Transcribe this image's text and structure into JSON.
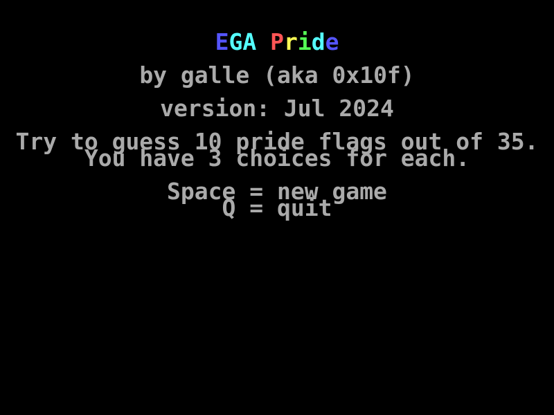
{
  "screen": {
    "background": "#000000",
    "text_color": "#AAAAAA"
  },
  "title": {
    "text": "EGA Pride",
    "letters": [
      {
        "char": "E",
        "color": "#5555FF"
      },
      {
        "char": "G",
        "color": "#55FFFF"
      },
      {
        "char": "A",
        "color": "#55FFFF"
      },
      {
        "char": " ",
        "color": "#000000"
      },
      {
        "char": "P",
        "color": "#FF5555"
      },
      {
        "char": "r",
        "color": "#FFFF55"
      },
      {
        "char": "i",
        "color": "#55FF55"
      },
      {
        "char": "d",
        "color": "#55FFFF"
      },
      {
        "char": "e",
        "color": "#5555FF"
      }
    ]
  },
  "author": "by galle (aka 0x10f)",
  "version": "version: Jul 2024",
  "instructions": {
    "line1": "Try to guess 10 pride flags out of 35.",
    "line2": "You have 3 choices for each."
  },
  "controls": {
    "new_game": "Space = new game",
    "quit": "Q = quit"
  }
}
